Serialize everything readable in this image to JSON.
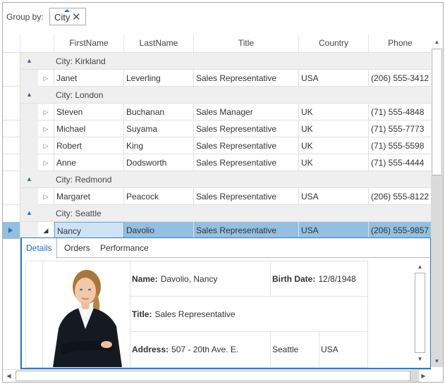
{
  "group_panel": {
    "label": "Group by:",
    "chips": [
      {
        "label": "City",
        "sort": "ascending",
        "close_icon": "close-icon"
      }
    ]
  },
  "columns": [
    "",
    "",
    "FirstName",
    "LastName",
    "Title",
    "Country",
    "Phone"
  ],
  "groups": [
    {
      "title": "City: Kirkland",
      "rows": [
        {
          "first": "Janet",
          "last": "Leverling",
          "title": "Sales Representative",
          "country": "USA",
          "phone": "(206) 555-3412"
        }
      ]
    },
    {
      "title": "City: London",
      "rows": [
        {
          "first": "Steven",
          "last": "Buchanan",
          "title": "Sales Manager",
          "country": "UK",
          "phone": "(71) 555-4848"
        },
        {
          "first": "Michael",
          "last": "Suyama",
          "title": "Sales Representative",
          "country": "UK",
          "phone": "(71) 555-7773"
        },
        {
          "first": "Robert",
          "last": "King",
          "title": "Sales Representative",
          "country": "UK",
          "phone": "(71) 555-5598"
        },
        {
          "first": "Anne",
          "last": "Dodsworth",
          "title": "Sales Representative",
          "country": "UK",
          "phone": "(71) 555-4444"
        }
      ]
    },
    {
      "title": "City: Redmond",
      "rows": [
        {
          "first": "Margaret",
          "last": "Peacock",
          "title": "Sales Representative",
          "country": "USA",
          "phone": "(206) 555-8122"
        }
      ]
    },
    {
      "title": "City: Seattle",
      "rows": [
        {
          "first": "Nancy",
          "last": "Davolio",
          "title": "Sales Representative",
          "country": "USA",
          "phone": "(206) 555-9857",
          "selected": true,
          "expanded": true
        }
      ]
    }
  ],
  "details": {
    "tabs": [
      "Details",
      "Orders",
      "Performance"
    ],
    "active_tab": "Details",
    "name_label": "Name:",
    "name_value": "Davolio, Nancy",
    "birth_label": "Birth Date:",
    "birth_value": "12/8/1948",
    "title_label": "Title:",
    "title_value": "Sales Representative",
    "address_label": "Address:",
    "address_value": "507 - 20th Ave. E.",
    "city_value": "Seattle",
    "country_value": "USA",
    "photo": "employee-photo"
  },
  "colors": {
    "selection": "#94bfe1",
    "current_cell": "#cde3f5",
    "accent": "#2b7bc8",
    "group_row": "#efefef"
  }
}
